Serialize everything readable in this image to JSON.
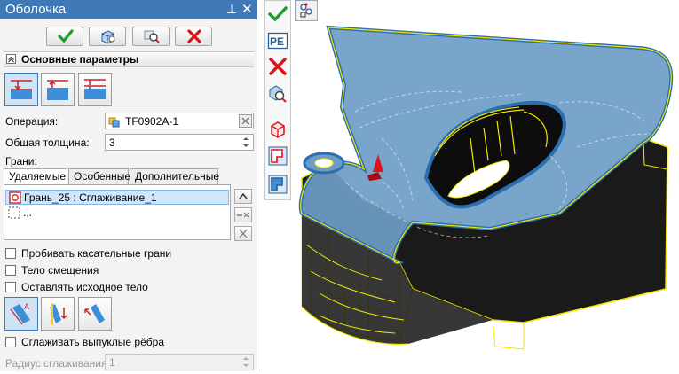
{
  "panel": {
    "title": "Оболочка",
    "pin_glyph": "⊥",
    "close_glyph": "✕"
  },
  "top_buttons": [
    {
      "name": "ok-button",
      "icon": "check-icon"
    },
    {
      "name": "preview-button",
      "icon": "preview-cube-icon"
    },
    {
      "name": "zoom-preview-button",
      "icon": "magnify-preview-icon"
    },
    {
      "name": "cancel-button",
      "icon": "red-x-icon"
    }
  ],
  "section": {
    "title": "Основные параметры",
    "collapse_glyph": "⌃"
  },
  "mode_buttons": [
    {
      "name": "direction-inward-button",
      "active": true
    },
    {
      "name": "direction-outward-button",
      "active": false
    },
    {
      "name": "direction-both-button",
      "active": false
    }
  ],
  "operation": {
    "label": "Операция:",
    "value": "TF0902A-1"
  },
  "thickness": {
    "label": "Общая толщина:",
    "value": "3"
  },
  "faces": {
    "label": "Грани:",
    "tabs": [
      "Удаляемые",
      "Особенные",
      "Дополнительные"
    ],
    "active_tab": 0,
    "items": [
      "Грань_25 : Сглаживание_1",
      "..."
    ]
  },
  "options": [
    {
      "label": "Пробивать касательные грани",
      "checked": false
    },
    {
      "label": "Тело смещения",
      "checked": false
    },
    {
      "label": "Оставлять исходное тело",
      "checked": false
    }
  ],
  "smooth": {
    "label": "Сглаживать выпуклые рёбра",
    "checked": false,
    "radius_label": "Радиус сглаживания:",
    "radius_value": "1"
  },
  "vertical_toolbar": [
    {
      "name": "apply-check-icon"
    },
    {
      "name": "parameters-pe-icon",
      "text": "PE"
    },
    {
      "name": "cancel-x-icon"
    },
    {
      "name": "zoom-preview-icon"
    },
    {
      "name": "cube-red-icon"
    },
    {
      "name": "shell-inward-icon"
    },
    {
      "name": "shell-outward-icon"
    }
  ],
  "colors": {
    "title_bar": "#3f79b8",
    "model_fill": "#6d9dc4",
    "model_edge_highlight": "#f2e600",
    "model_dark": "#1a1a1a",
    "accept_green": "#1e9d2e",
    "cancel_red": "#d8141a"
  }
}
